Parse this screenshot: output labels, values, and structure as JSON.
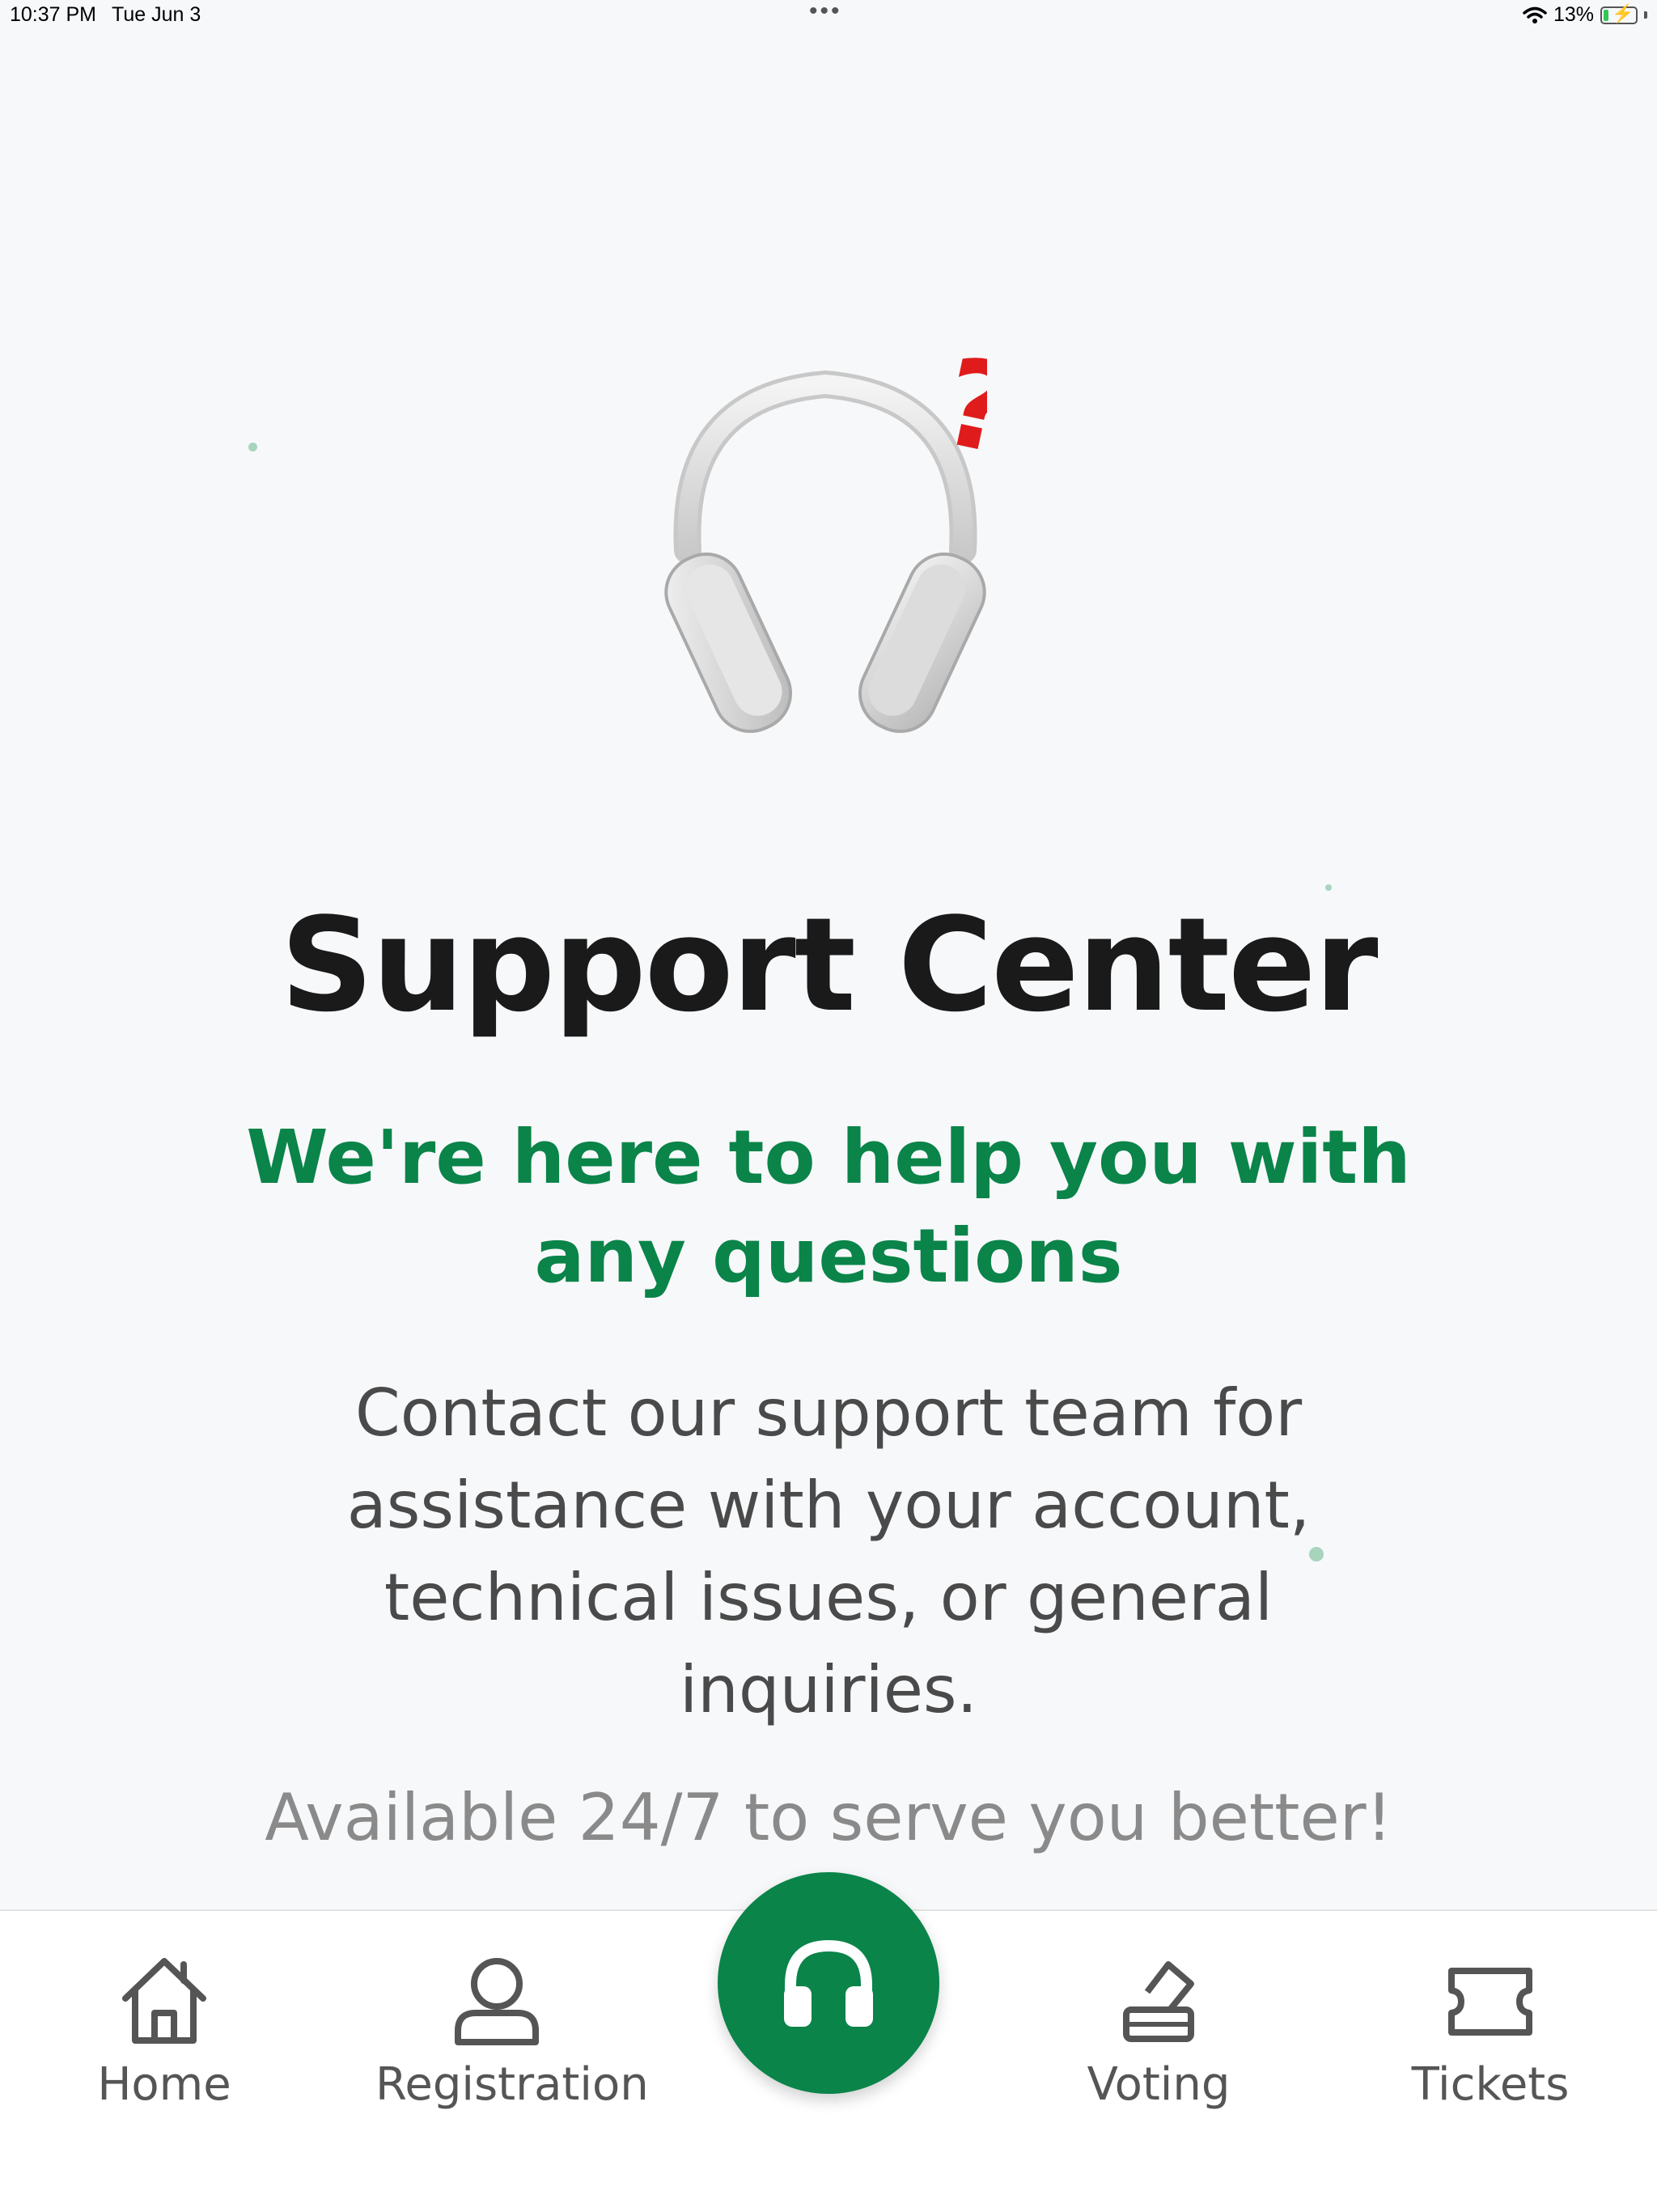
{
  "status_bar": {
    "time": "10:37 PM",
    "date": "Tue Jun 3",
    "battery": "13%",
    "battery_level": 0.13,
    "icons": [
      "wifi-icon",
      "battery-charging-icon"
    ]
  },
  "hero": {
    "icon": "headphones-question-icon",
    "title": "Support Center",
    "subtitle": "We're here to help you with any questions",
    "description": "Contact our support team for assistance with your account, technical issues, or general inquiries.",
    "availability": "Available 24/7 to serve you better!"
  },
  "nav": {
    "items": [
      {
        "label": "Home",
        "icon": "home-icon"
      },
      {
        "label": "Registration",
        "icon": "user-icon"
      },
      {
        "label": "Voting",
        "icon": "voting-icon"
      },
      {
        "label": "Tickets",
        "icon": "ticket-icon"
      }
    ],
    "center_icon": "headphones-icon",
    "active_color": "#0a8449"
  },
  "colors": {
    "accent": "#0a8449",
    "background": "#f7f8fa"
  }
}
